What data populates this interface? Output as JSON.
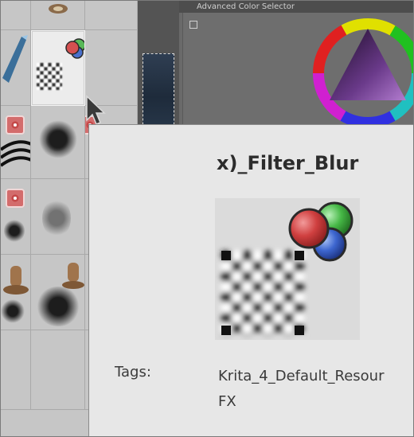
{
  "docker": {
    "title": "Advanced Color Selector"
  },
  "tooltip": {
    "title": "x)_Filter_Blur",
    "tags_label": "Tags:",
    "tags_line1": "Krita_4_Default_Resour",
    "tags_line2": "FX"
  },
  "colors": {
    "tooltip_bg": "#e7e7e7",
    "selected_cell": "#ececec",
    "panel_bg": "#c6c6c6",
    "docker_bg": "#6e6e6e"
  },
  "icons": {
    "preset_icon": "filter-blur-preset-icon",
    "rgb_circles": "rgb-circles-icon",
    "cursor": "mouse-pointer-icon"
  }
}
